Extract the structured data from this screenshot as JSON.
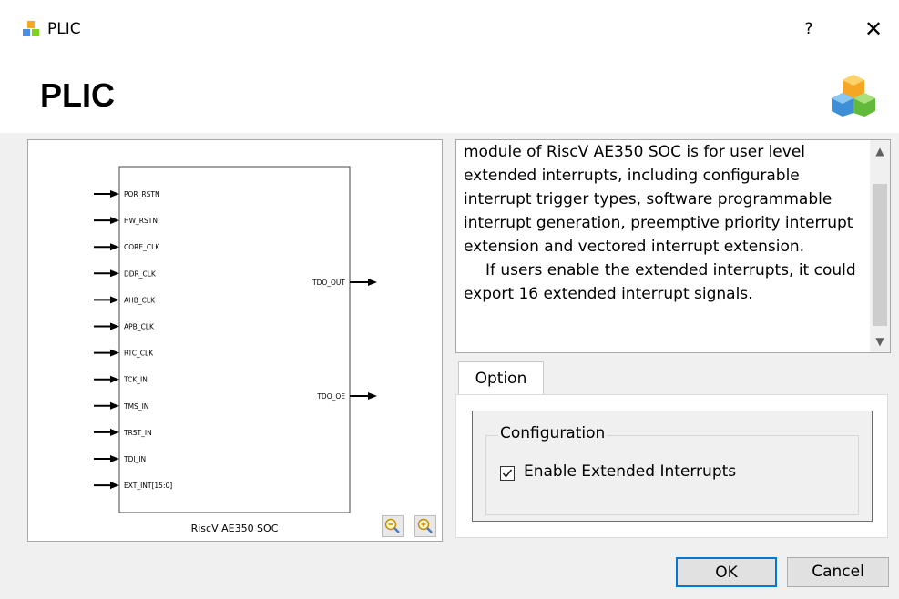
{
  "window": {
    "title": "PLIC",
    "help_label": "?",
    "close_label": "✕"
  },
  "header": {
    "title": "PLIC",
    "logo_icon": "cubes-icon"
  },
  "diagram": {
    "block_name": "RiscV AE350 SOC",
    "inputs": [
      "POR_RSTN",
      "HW_RSTN",
      "CORE_CLK",
      "DDR_CLK",
      "AHB_CLK",
      "APB_CLK",
      "RTC_CLK",
      "TCK_IN",
      "TMS_IN",
      "TRST_IN",
      "TDI_IN",
      "EXT_INT[15:0]"
    ],
    "outputs": [
      "TDO_OUT",
      "TDO_OE"
    ],
    "zoom_in_icon": "zoom-in-icon",
    "zoom_out_icon": "zoom-out-icon"
  },
  "description": {
    "paragraph1": "module of RiscV AE350 SOC is for user level extended interrupts, including configurable interrupt trigger types, software programmable interrupt generation, preemptive priority interrupt extension and vectored interrupt extension.",
    "paragraph2": "If users enable the extended interrupts, it could export 16 extended interrupt signals."
  },
  "tabs": [
    {
      "label": "Option",
      "active": true
    }
  ],
  "option": {
    "group_title": "Configuration",
    "checkbox_label": "Enable Extended Interrupts",
    "checkbox_checked": true
  },
  "buttons": {
    "ok": "OK",
    "cancel": "Cancel"
  },
  "colors": {
    "accent": "#0078d7",
    "background": "#f0f0f0"
  }
}
